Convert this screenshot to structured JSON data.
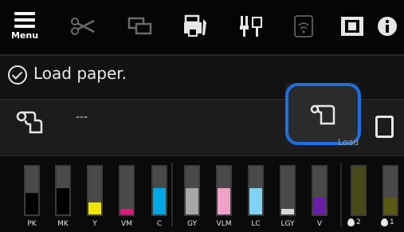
{
  "toolbar": {
    "menu_label": "Menu",
    "icons": [
      "menu-icon",
      "scissors-icon",
      "tray-icon",
      "printer-wrench-icon",
      "network-icon",
      "wifi-icon",
      "book-icon",
      "info-icon"
    ]
  },
  "status": {
    "text": "Load paper."
  },
  "paper": {
    "roll_value": "---",
    "load_label": "Load"
  },
  "ink": [
    {
      "label": "PK",
      "color": "#000000",
      "level": 0.45
    },
    {
      "label": "MK",
      "color": "#000000",
      "level": 0.55
    },
    {
      "label": "Y",
      "color": "#f1e400",
      "level": 0.25
    },
    {
      "label": "VM",
      "color": "#e4157d",
      "level": 0.12
    },
    {
      "label": "C",
      "color": "#00a8e6",
      "level": 0.55
    },
    {
      "label": "GY",
      "color": "#a7a7a7",
      "level": 0.55
    },
    {
      "label": "VLM",
      "color": "#f0a1c8",
      "level": 0.55
    },
    {
      "label": "LC",
      "color": "#7fd3f4",
      "level": 0.55
    },
    {
      "label": "LGY",
      "color": "#d6d6d6",
      "level": 0.12
    },
    {
      "label": "V",
      "color": "#6a1ea6",
      "level": 0.35
    }
  ],
  "maintenance": [
    {
      "label": "2",
      "color": "#4a4a18",
      "level": 1.0
    },
    {
      "label": "1",
      "color": "#5a5a12",
      "level": 0.35
    }
  ]
}
